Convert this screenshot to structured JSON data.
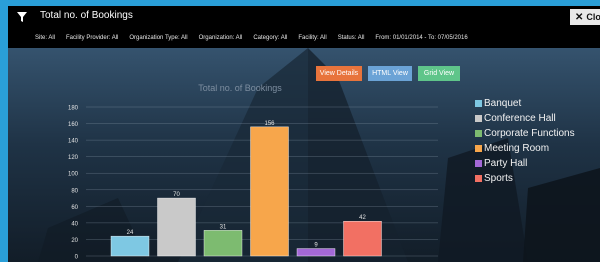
{
  "window": {
    "title": "Total no. of Bookings",
    "close_label": "Close"
  },
  "filters": [
    "Site: All",
    "Facility Provider: All",
    "Organization Type: All",
    "Organization: All",
    "Category: All",
    "Facility: All",
    "Status: All",
    "From: 01/01/2014 - To: 07/05/2016"
  ],
  "buttons": {
    "view_details": "View Details",
    "html_view": "HTML View",
    "grid_view": "Grid View"
  },
  "colors": {
    "view_details": "#e8743c",
    "html_view": "#6ba3d6",
    "grid_view": "#5fc58a"
  },
  "chart_data": {
    "type": "bar",
    "title": "Total no. of Bookings",
    "categories": [
      "Banquet",
      "Conference Hall",
      "Corporate Functions",
      "Meeting Room",
      "Party  Hall",
      "Sports"
    ],
    "values": [
      24,
      70,
      31,
      156,
      9,
      42
    ],
    "value_labels": [
      "24",
      "70",
      "31",
      "156",
      "9",
      "42"
    ],
    "colors": [
      "#7ec8e3",
      "#c9c9c9",
      "#7dbb70",
      "#f7a64b",
      "#a368d6",
      "#f27063"
    ],
    "yticks": [
      "0",
      "20",
      "40",
      "60",
      "80",
      "100",
      "120",
      "140",
      "160",
      "180"
    ],
    "ylim": [
      0,
      180
    ],
    "grid": true,
    "legend": "right"
  }
}
